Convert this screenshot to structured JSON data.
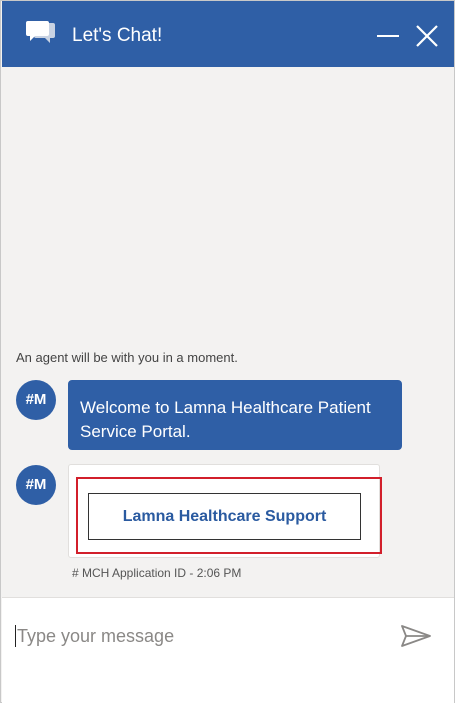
{
  "header": {
    "title": "Let's Chat!",
    "icons": {
      "chat": "chat-bubbles-icon",
      "minimize": "minimize-icon",
      "close": "close-icon"
    },
    "background_color": "#2f5fa6"
  },
  "conversation": {
    "system_message": "An agent will be with you in a moment.",
    "messages": [
      {
        "avatar_initials": "#M",
        "text": "Welcome to Lamna Healthcare Patient Service Portal."
      },
      {
        "avatar_initials": "#M",
        "button_label": "Lamna Healthcare Support"
      }
    ],
    "timestamp": "# MCH Application ID - 2:06 PM",
    "highlight_color": "#d21f2b"
  },
  "composer": {
    "placeholder": "Type your message",
    "value": "",
    "send_icon": "send-icon"
  }
}
